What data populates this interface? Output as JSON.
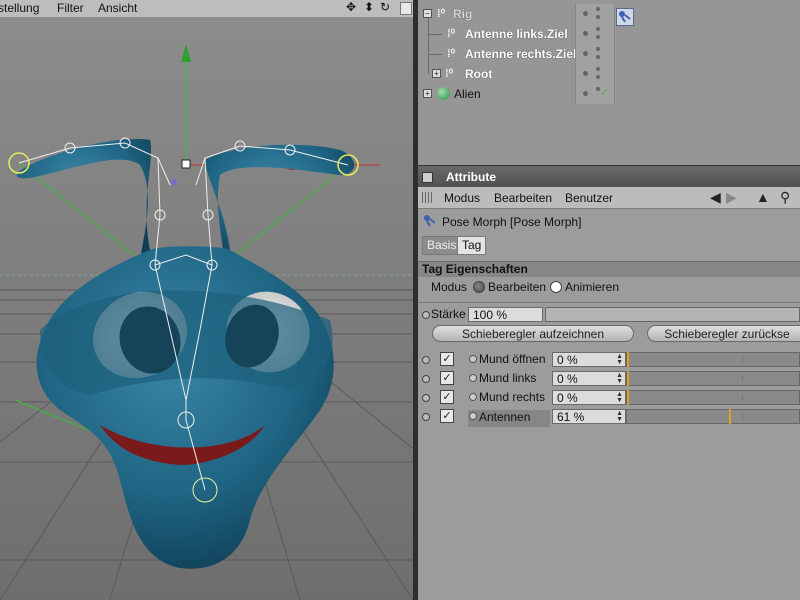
{
  "viewport": {
    "menus": [
      "stellung",
      "Filter",
      "Ansicht"
    ],
    "nav_icons": [
      "move-icon",
      "zoom-icon",
      "rotate-icon",
      "maximize-icon"
    ]
  },
  "object_manager": {
    "objects": [
      {
        "name": "Rig",
        "indent": 0,
        "expanded": true
      },
      {
        "name": "Antenne links.Ziel",
        "indent": 1
      },
      {
        "name": "Antenne rechts.Ziel",
        "indent": 1
      },
      {
        "name": "Root",
        "indent": 1,
        "expanded": false
      },
      {
        "name": "Alien",
        "indent": 0,
        "expanded": false
      }
    ]
  },
  "attribute_manager": {
    "title": "Attribute",
    "menus": [
      "Modus",
      "Bearbeiten",
      "Benutzer"
    ],
    "object_title": "Pose Morph [Pose Morph]",
    "tabs": [
      {
        "label": "Basis",
        "active": false
      },
      {
        "label": "Tag",
        "active": true
      }
    ],
    "section_title": "Tag Eigenschaften",
    "modus": {
      "label": "Modus",
      "options": [
        {
          "label": "Bearbeiten",
          "selected": false
        },
        {
          "label": "Animieren",
          "selected": true
        }
      ]
    },
    "strength": {
      "label": "Stärke",
      "value": "100 %",
      "fraction": 1.0
    },
    "buttons": {
      "record": "Schieberegler aufzeichnen",
      "reset": "Schieberegler zurückse"
    },
    "morphs": [
      {
        "label": "Mund öffnen",
        "value": "0 %",
        "fraction": 0.0
      },
      {
        "label": "Mund links",
        "value": "0 %",
        "fraction": 0.0
      },
      {
        "label": "Mund rechts",
        "value": "0 %",
        "fraction": 0.0
      },
      {
        "label": "Antennen",
        "value": "61 %",
        "fraction": 0.61
      }
    ]
  }
}
